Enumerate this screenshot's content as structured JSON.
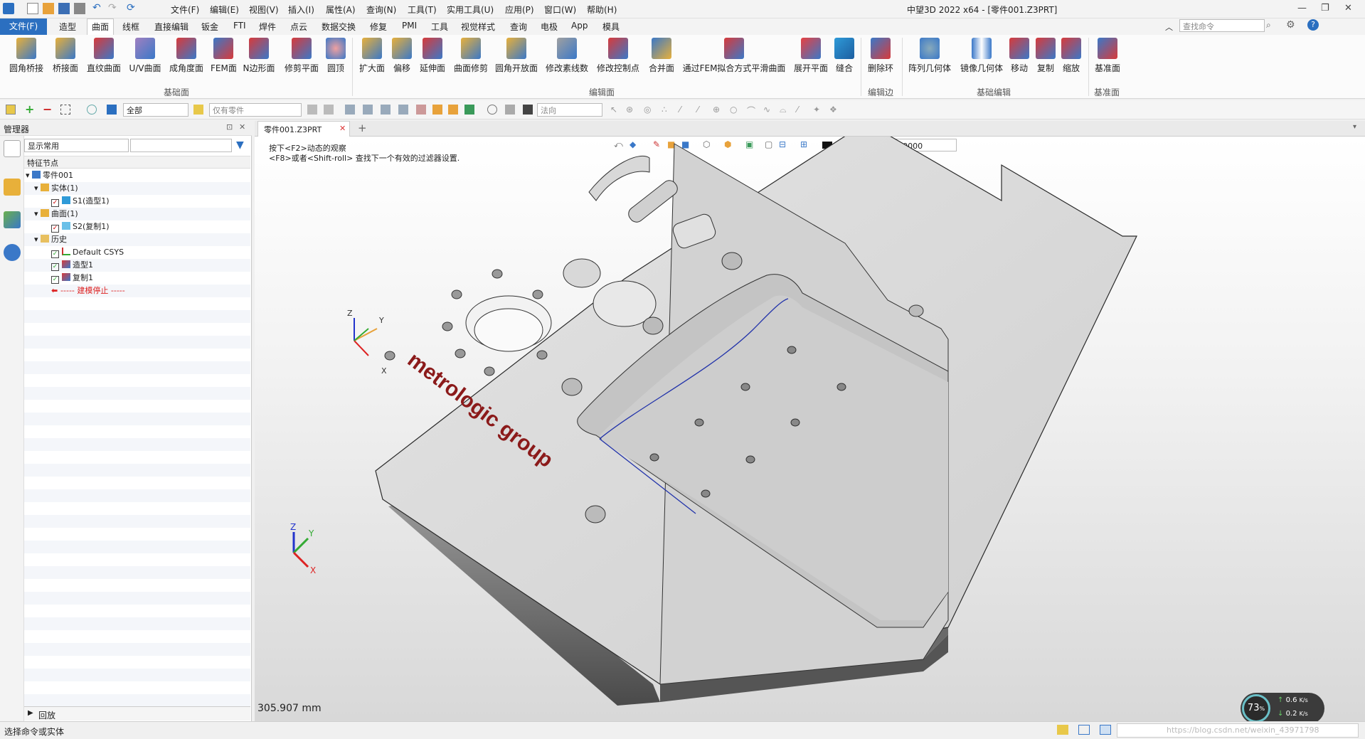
{
  "app": {
    "title": "中望3D 2022 x64 - [零件001.Z3PRT]"
  },
  "menu": [
    "文件(F)",
    "编辑(E)",
    "视图(V)",
    "插入(I)",
    "属性(A)",
    "查询(N)",
    "工具(T)",
    "实用工具(U)",
    "应用(P)",
    "窗口(W)",
    "帮助(H)"
  ],
  "ribbon_tabs": [
    "文件(F)",
    "造型",
    "曲面",
    "线框",
    "直接编辑",
    "钣金",
    "FTI",
    "焊件",
    "点云",
    "数据交换",
    "修复",
    "PMI",
    "工具",
    "视觉样式",
    "查询",
    "电极",
    "App",
    "模具"
  ],
  "active_tab": "曲面",
  "search_placeholder": "查找命令",
  "ribbon_buttons": [
    "圆角桥接",
    "桥接面",
    "直纹曲面",
    "U/V曲面",
    "成角度面",
    "FEM面",
    "N边形面",
    "修剪平面",
    "圆顶",
    "扩大面",
    "偏移",
    "延伸面",
    "曲面修剪",
    "圆角开放面",
    "修改素线数",
    "修改控制点",
    "合并面",
    "通过FEM拟合方式平滑曲面",
    "展开平面",
    "缝合",
    "删除环",
    "阵列几何体",
    "镜像几何体",
    "移动",
    "复制",
    "缩放",
    "基准面"
  ],
  "ribbon_groups": [
    "基础面",
    "编辑面",
    "编辑边",
    "基础编辑",
    "基准面"
  ],
  "toolbar": {
    "filter_value": "全部",
    "parts_only": "仅有零件",
    "direction": "法向"
  },
  "manager": {
    "title": "管理器",
    "display_filter": "显示常用",
    "column_header": "特征节点",
    "tree": [
      {
        "label": "零件001"
      },
      {
        "label": "实体(1)"
      },
      {
        "label": "S1(造型1)"
      },
      {
        "label": "曲面(1)"
      },
      {
        "label": "S2(复制1)"
      },
      {
        "label": "历史"
      },
      {
        "label": "Default CSYS"
      },
      {
        "label": "造型1"
      },
      {
        "label": "复制1"
      },
      {
        "label": "----- 建模停止 -----"
      }
    ],
    "footer": "回放"
  },
  "document": {
    "tab": "零件001.Z3PRT",
    "hint_line1": "按下<F2>动态的观察",
    "hint_line2": "<F8>或者<Shift-roll> 查找下一个有效的过滤器设置.",
    "layer": "图层0000",
    "logo_text": "metrologic group",
    "scale": "305.907 mm",
    "axes": {
      "x": "X",
      "y": "Y",
      "z": "Z"
    }
  },
  "status": {
    "prompt": "选择命令或实体",
    "cpu": "73",
    "cpu_unit": "%",
    "net_up": "0.6",
    "net_down": "0.2",
    "net_unit": "K/s",
    "watermark": "https://blog.csdn.net/weixin_43971798"
  },
  "colors": {
    "accent": "#2b6fc0",
    "logo": "#8b1a1a",
    "part": "#d6d6d6",
    "edge_curve": "#2233aa"
  }
}
